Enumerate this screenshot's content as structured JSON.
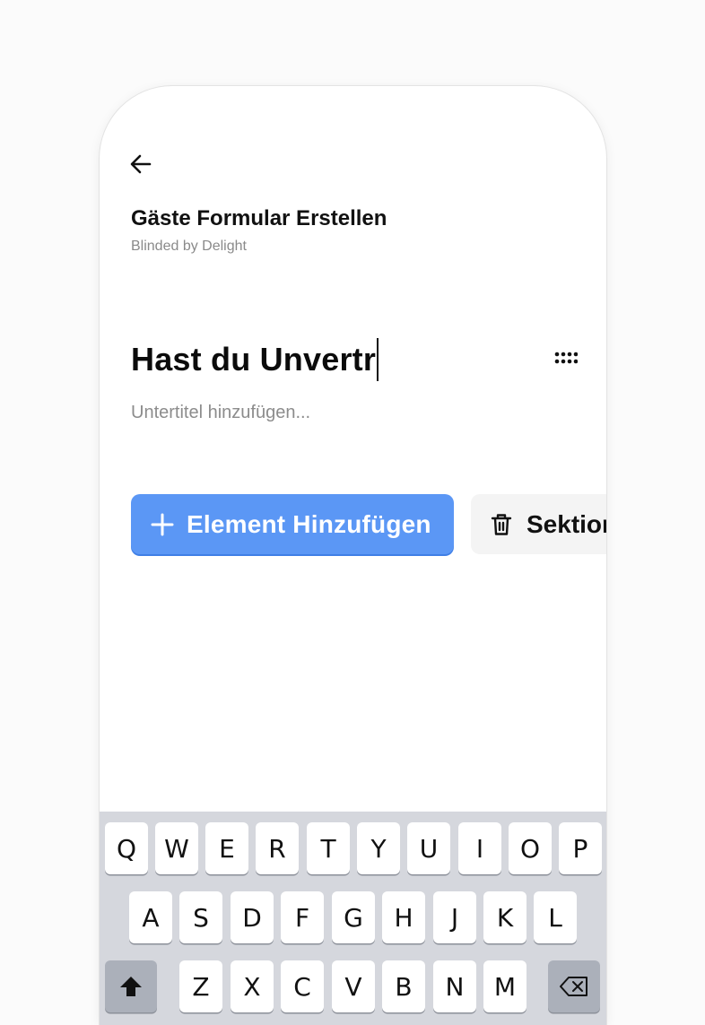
{
  "header": {
    "back_icon": "arrow-left-icon",
    "title": "Gäste Formular Erstellen",
    "subtitle": "Blinded by Delight"
  },
  "section": {
    "title_value": "Hast du Unvertr",
    "subtitle_placeholder": "Untertitel hinzufügen...",
    "drag_icon": "drag-handle-icon"
  },
  "actions": {
    "add_label": "Element Hinzufügen",
    "add_icon": "plus-icon",
    "add_color": "#5b97f5",
    "delete_label": "Sektion",
    "delete_icon": "trash-icon"
  },
  "keyboard": {
    "row1": [
      "Q",
      "W",
      "E",
      "R",
      "T",
      "Y",
      "U",
      "I",
      "O",
      "P"
    ],
    "row2": [
      "A",
      "S",
      "D",
      "F",
      "G",
      "H",
      "J",
      "K",
      "L"
    ],
    "row3": [
      "Z",
      "X",
      "C",
      "V",
      "B",
      "N",
      "M"
    ],
    "shift_icon": "shift-icon",
    "backspace_icon": "backspace-icon"
  }
}
